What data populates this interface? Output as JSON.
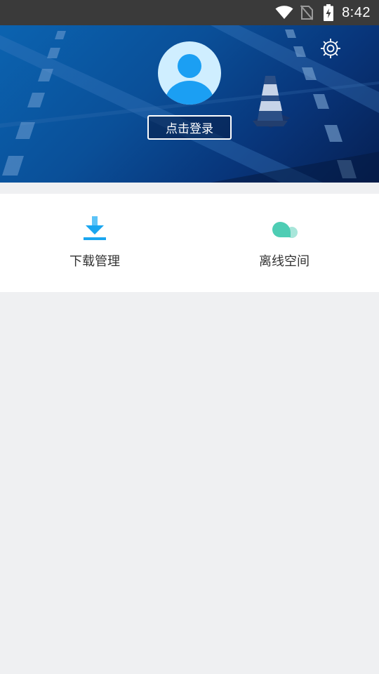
{
  "status_bar": {
    "time": "8:42",
    "icons": [
      "wifi-icon",
      "no-sim-icon",
      "battery-charging-icon"
    ]
  },
  "header": {
    "settings_icon": "gear-icon",
    "avatar_icon": "user-avatar-icon",
    "login_label": "点击登录"
  },
  "quick_actions": [
    {
      "label": "下载管理",
      "icon": "download-icon",
      "color": "#1aa6f0"
    },
    {
      "label": "离线空间",
      "icon": "cloud-icon",
      "color": "#4ecdb4"
    }
  ],
  "colors": {
    "status_bar_bg": "#3a3a3a",
    "header_bg": "#0a4f98",
    "page_bg": "#eff0f2",
    "accent_blue": "#1aa6f0",
    "accent_teal": "#4ecdb4"
  }
}
